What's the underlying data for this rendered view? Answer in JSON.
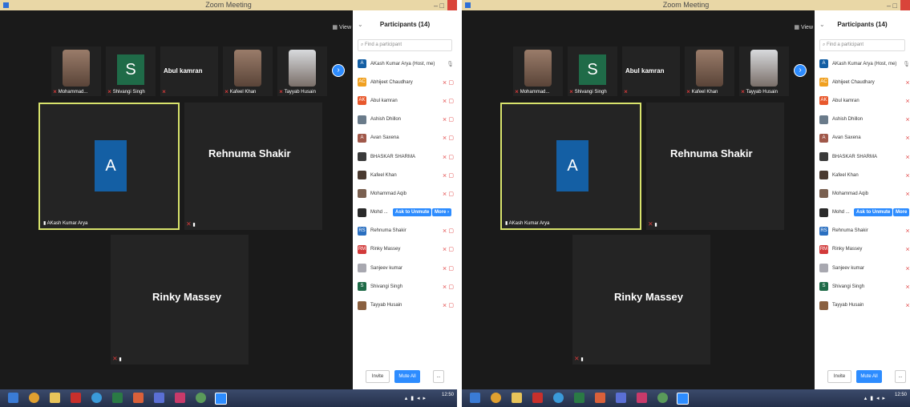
{
  "window": {
    "title": "Zoom Meeting"
  },
  "toolbar": {
    "view_label": "View"
  },
  "thumbnails": [
    {
      "name": "Mohammad...",
      "kind": "photo"
    },
    {
      "name": "Shivangi Singh",
      "kind": "letter",
      "letter": "S"
    },
    {
      "name": "Abul kamran",
      "kind": "name"
    },
    {
      "name": "Kafeel Khan",
      "kind": "photo"
    },
    {
      "name": "Tayyab Husain",
      "kind": "photo"
    }
  ],
  "gallery": {
    "active": {
      "avatar_letter": "A",
      "label": "AKash Kumar Arya"
    },
    "tile2": {
      "name": "Rehnuma Shakir"
    },
    "tile3": {
      "name": "Rinky Massey"
    }
  },
  "participants": {
    "title": "Participants (14)",
    "search_placeholder": "Find a participant",
    "list": [
      {
        "initials": "A",
        "name": "AKash Kumar Arya (Host, me)",
        "color": "#145fa4"
      },
      {
        "initials": "AC",
        "name": "Abhijeet Chaudhary",
        "color": "#f0a020"
      },
      {
        "initials": "AK",
        "name": "Abul kamran",
        "color": "#e8582c"
      },
      {
        "initials": "",
        "name": "Ashish Dhillon",
        "color": "#6a7b8a"
      },
      {
        "initials": "A",
        "name": "Avan Saxena",
        "color": "#a0584a"
      },
      {
        "initials": "",
        "name": "BHASKAR SHARMA",
        "color": "#3a3a3a"
      },
      {
        "initials": "",
        "name": "Kafeel Khan",
        "color": "#4a3a30"
      },
      {
        "initials": "",
        "name": "Mohammad Aqib",
        "color": "#7a6050"
      },
      {
        "initials": "",
        "name": "Mohd ...",
        "color": "#2a2a2a",
        "unmute": "Ask to Unmute",
        "more": "More"
      },
      {
        "initials": "RS",
        "name": "Rehnuma Shakir",
        "color": "#2a6fc0"
      },
      {
        "initials": "RM",
        "name": "Rinky Massey",
        "color": "#d23a3a"
      },
      {
        "initials": "",
        "name": "Sanjeev kumar",
        "color": "#a8a8b0"
      },
      {
        "initials": "S",
        "name": "Shivangi Singh",
        "color": "#1f6b48"
      },
      {
        "initials": "",
        "name": "Tayyab Husain",
        "color": "#8a6040"
      }
    ],
    "invite_label": "Invite",
    "mute_all_label": "Mute All",
    "more_label": "..."
  },
  "clock": {
    "time": "12:50"
  }
}
